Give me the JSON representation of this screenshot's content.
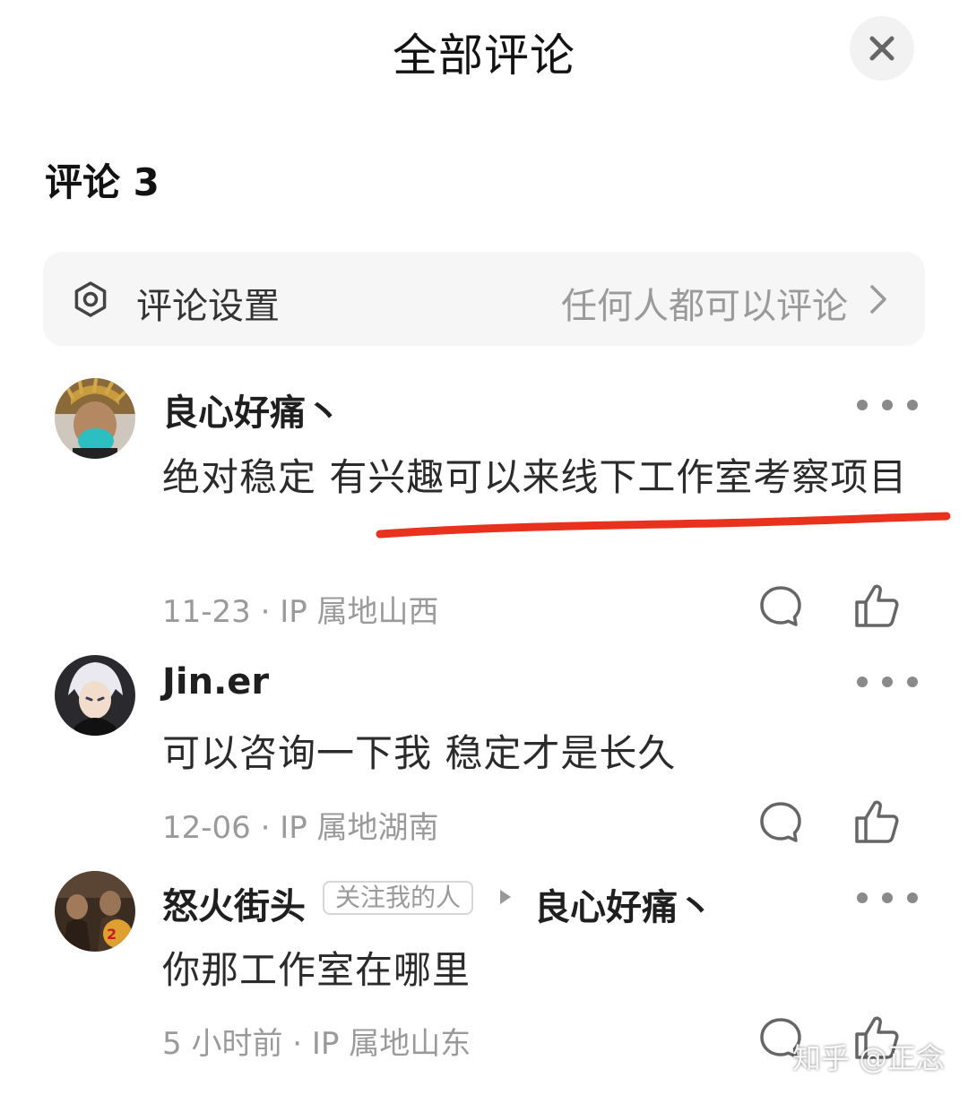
{
  "header": {
    "title": "全部评论"
  },
  "comment_count_label": "评论 3",
  "settings": {
    "label": "评论设置",
    "value": "任何人都可以评论"
  },
  "comments": [
    {
      "username": "良心好痛丶",
      "text": "绝对稳定 有兴趣可以来线下工作室考察项目",
      "meta": "11-23 · IP 属地山西"
    },
    {
      "username": "Jin.er",
      "text": "可以咨询一下我 稳定才是长久",
      "meta": "12-06 · IP 属地湖南"
    },
    {
      "username": "怒火街头",
      "tag": "关注我的人",
      "reply_to": "良心好痛丶",
      "text": "你那工作室在哪里",
      "meta": "5 小时前 · IP 属地山东"
    }
  ],
  "watermark": "知乎 @正念",
  "colors": {
    "annotation_red": "#e8321e",
    "muted_text": "#9a9a9a",
    "settings_bg": "#f6f6f6"
  }
}
